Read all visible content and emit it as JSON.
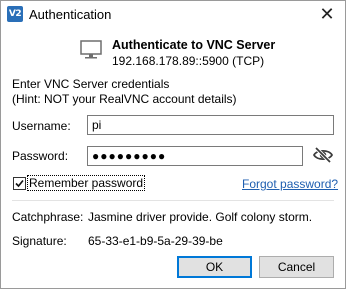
{
  "window": {
    "title": "Authentication",
    "app_icon_text": "V2",
    "close_glyph": "✕"
  },
  "header": {
    "icon": "monitor-icon",
    "title": "Authenticate to VNC Server",
    "subtitle": "192.168.178.89::5900 (TCP)"
  },
  "prompt": {
    "line1": "Enter VNC Server credentials",
    "line2": "(Hint: NOT your RealVNC account details)"
  },
  "username": {
    "label": "Username:",
    "value": "pi"
  },
  "password": {
    "label": "Password:",
    "masked_value": "●●●●●●●●●",
    "toggle_icon": "eye-slash-icon"
  },
  "remember": {
    "label": "Remember password",
    "checked": true
  },
  "forgot_link": "Forgot password?",
  "catchphrase": {
    "label": "Catchphrase:",
    "value": "Jasmine driver provide. Golf colony storm."
  },
  "signature": {
    "label": "Signature:",
    "value": "65-33-e1-b9-5a-29-39-be"
  },
  "buttons": {
    "ok": "OK",
    "cancel": "Cancel"
  },
  "colors": {
    "link": "#1f5fb0",
    "focus_border": "#0078d7",
    "app_icon": "#2a6fb8"
  }
}
